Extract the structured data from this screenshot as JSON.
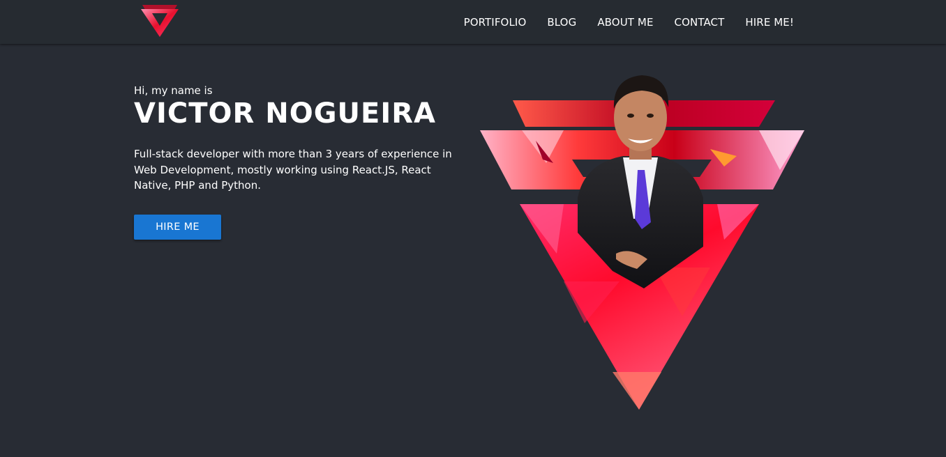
{
  "nav": {
    "items": [
      {
        "label": "PORTIFOLIO"
      },
      {
        "label": "BLOG"
      },
      {
        "label": "ABOUT ME"
      },
      {
        "label": "CONTACT"
      },
      {
        "label": "HIRE ME!"
      }
    ]
  },
  "hero": {
    "greeting": "Hi, my name is",
    "name": "VICTOR NOGUEIRA",
    "bio": "Full-stack developer with more than 3 years of experience in Web Development, mostly working using React.JS, React Native, PHP and Python.",
    "button_label": "HIRE ME"
  },
  "colors": {
    "background": "#282c34",
    "navbar": "#262b31",
    "accent": "#1976d2",
    "brand_red": "#ff1744",
    "brand_pink": "#ff4081"
  },
  "icons": {
    "logo": "v-triangle-logo"
  }
}
